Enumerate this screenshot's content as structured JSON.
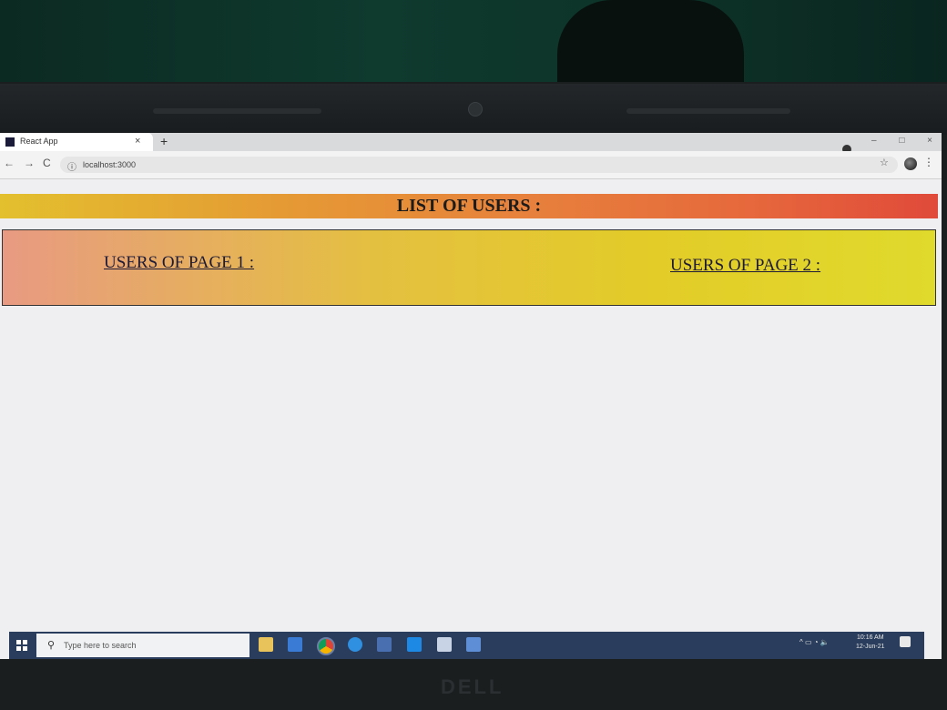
{
  "browser": {
    "tab_title": "React App",
    "tab_close": "×",
    "new_tab": "+",
    "url": "localhost:3000",
    "back": "←",
    "forward": "→",
    "reload": "C",
    "star": "☆",
    "menu": "⋮",
    "window_buttons": [
      "–",
      "□",
      "×"
    ]
  },
  "app": {
    "heading": "LIST OF USERS :",
    "page1_label": "USERS OF PAGE 1 :",
    "page2_label": "USERS OF PAGE 2 :"
  },
  "taskbar": {
    "search_placeholder": "Type here to search",
    "time": "10:16 AM",
    "date": "12-Jun-21",
    "icons": [
      "file-explorer-icon",
      "store-icon",
      "chrome-icon",
      "edge-icon",
      "calculator-icon",
      "vscode-icon",
      "app-icon",
      "photos-icon"
    ]
  },
  "hardware": {
    "brand": "DELL"
  },
  "colors": {
    "header_gradient": [
      "#e3c02e",
      "#e7823c",
      "#e04a3a"
    ],
    "users_box_gradient": [
      "#e89a82",
      "#e4c040",
      "#e0da2c"
    ],
    "taskbar": "#2a3d5c"
  }
}
